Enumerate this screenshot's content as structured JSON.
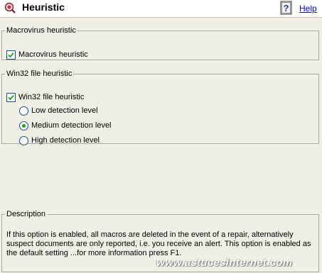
{
  "header": {
    "title": "Heuristic",
    "help_label": "Help"
  },
  "macrovirus_group": {
    "legend": "Macrovirus heuristic",
    "checkbox_label": "Macrovirus heuristic",
    "checked": true
  },
  "win32_group": {
    "legend": "Win32 file heuristic",
    "checkbox_label": "Win32 file heuristic",
    "checked": true,
    "levels": [
      {
        "label": "Low detection level",
        "selected": false
      },
      {
        "label": "Medium detection level",
        "selected": true
      },
      {
        "label": "High detection level",
        "selected": false
      }
    ]
  },
  "description": {
    "legend": "Description",
    "text": "If this option is enabled, all macros are deleted in the event of a repair, alternatively suspect documents are only reported, i.e. you receive an alert. This option is enabled as the default setting ...for more information press F1."
  },
  "watermark": "www.astucesinternet.com",
  "colors": {
    "header_bg": "#ffffff",
    "panel_bg": "#f0efe6",
    "link": "#0000cc",
    "radio_dot": "#21a121"
  }
}
